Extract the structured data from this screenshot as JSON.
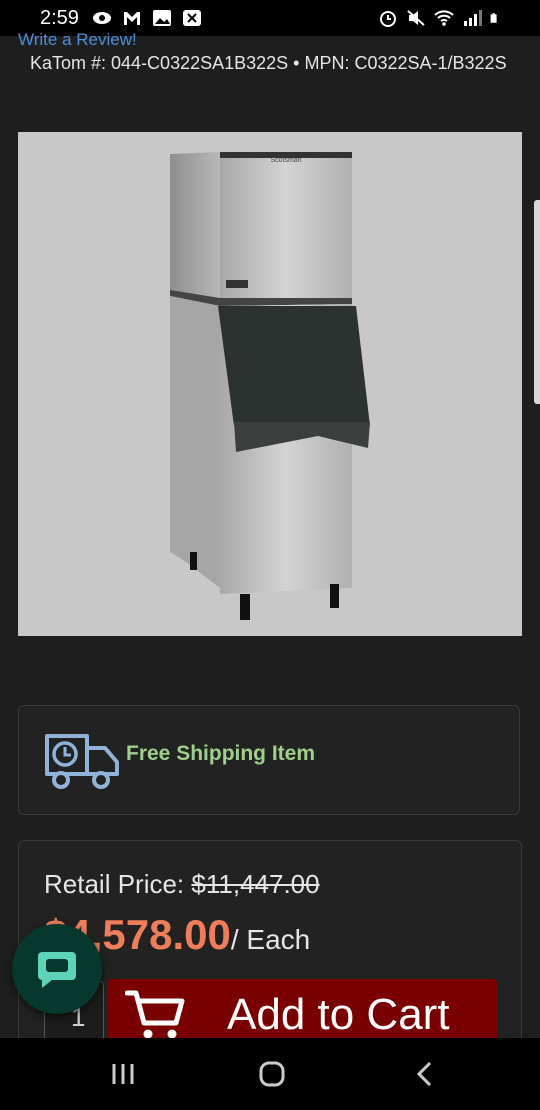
{
  "status": {
    "time": "2:59"
  },
  "header": {
    "write_review": "Write a Review!",
    "sku_text": "KaTom #: 044-C0322SA1B322S • MPN: C0322SA-1/B322S"
  },
  "product_image": {
    "label": "Scotsman"
  },
  "shipping": {
    "label": "Free Shipping Item",
    "label_color": "#9fd08a"
  },
  "pricing": {
    "retail_label": "Retail Price: ",
    "retail_value": "$11,447.00",
    "price": "$4,578.00",
    "per_unit": "/ Each",
    "price_color": "#f07d5a"
  },
  "cart": {
    "quantity": "1",
    "add_label": "Add to Cart",
    "button_color": "#7a0000"
  },
  "icons": {
    "truck": "truck-clock-icon",
    "cart": "shopping-cart-icon",
    "chat": "chat-bubble-icon"
  }
}
